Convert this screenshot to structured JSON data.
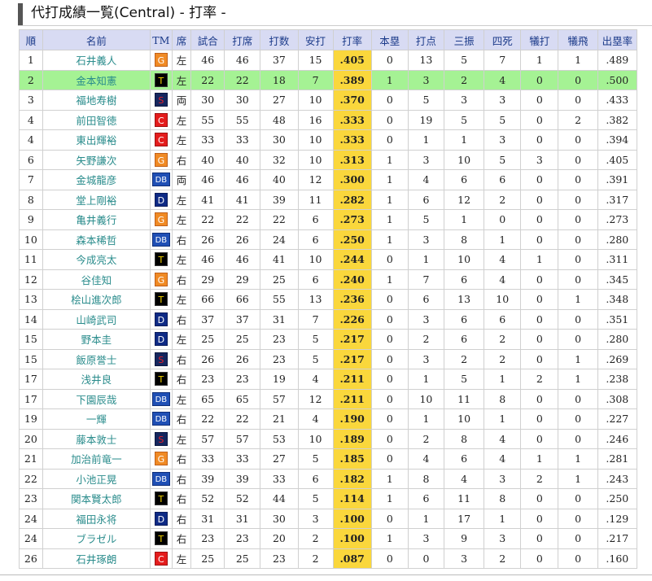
{
  "title": "代打成績一覧(Central) - 打率 -",
  "columns": [
    "順",
    "名前",
    "TM",
    "席",
    "試合",
    "打席",
    "打数",
    "安打",
    "打率",
    "本塁",
    "打点",
    "三振",
    "四死",
    "犠打",
    "犠飛",
    "出塁率"
  ],
  "colors": {
    "header_bg": "#d8dbf3",
    "avg_bg": "#fad73c",
    "highlight_row": "#a5f294",
    "name_text": "#2a8c8c"
  },
  "rows": [
    {
      "rank": "1",
      "name": "石井義人",
      "tm": "G",
      "hand": "左",
      "g": "46",
      "pa": "46",
      "ab": "37",
      "h": "15",
      "avg": ".405",
      "hr": "0",
      "rbi": "13",
      "so": "5",
      "bb": "7",
      "sh": "1",
      "sf": "1",
      "obp": ".489"
    },
    {
      "rank": "2",
      "name": "金本知憲",
      "tm": "T",
      "hand": "左",
      "g": "22",
      "pa": "22",
      "ab": "18",
      "h": "7",
      "avg": ".389",
      "hr": "1",
      "rbi": "3",
      "so": "2",
      "bb": "4",
      "sh": "0",
      "sf": "0",
      "obp": ".500",
      "highlight": true
    },
    {
      "rank": "3",
      "name": "福地寿樹",
      "tm": "S",
      "hand": "両",
      "g": "30",
      "pa": "30",
      "ab": "27",
      "h": "10",
      "avg": ".370",
      "hr": "0",
      "rbi": "5",
      "so": "3",
      "bb": "3",
      "sh": "0",
      "sf": "0",
      "obp": ".433"
    },
    {
      "rank": "4",
      "name": "前田智徳",
      "tm": "C",
      "hand": "左",
      "g": "55",
      "pa": "55",
      "ab": "48",
      "h": "16",
      "avg": ".333",
      "hr": "0",
      "rbi": "19",
      "so": "5",
      "bb": "5",
      "sh": "0",
      "sf": "2",
      "obp": ".382"
    },
    {
      "rank": "4",
      "name": "東出輝裕",
      "tm": "C",
      "hand": "左",
      "g": "33",
      "pa": "33",
      "ab": "30",
      "h": "10",
      "avg": ".333",
      "hr": "0",
      "rbi": "1",
      "so": "1",
      "bb": "3",
      "sh": "0",
      "sf": "0",
      "obp": ".394"
    },
    {
      "rank": "6",
      "name": "矢野謙次",
      "tm": "G",
      "hand": "右",
      "g": "40",
      "pa": "40",
      "ab": "32",
      "h": "10",
      "avg": ".313",
      "hr": "1",
      "rbi": "3",
      "so": "10",
      "bb": "5",
      "sh": "3",
      "sf": "0",
      "obp": ".405"
    },
    {
      "rank": "7",
      "name": "金城龍彦",
      "tm": "DB",
      "hand": "両",
      "g": "46",
      "pa": "46",
      "ab": "40",
      "h": "12",
      "avg": ".300",
      "hr": "1",
      "rbi": "4",
      "so": "6",
      "bb": "6",
      "sh": "0",
      "sf": "0",
      "obp": ".391"
    },
    {
      "rank": "8",
      "name": "堂上剛裕",
      "tm": "D",
      "hand": "左",
      "g": "41",
      "pa": "41",
      "ab": "39",
      "h": "11",
      "avg": ".282",
      "hr": "1",
      "rbi": "6",
      "so": "12",
      "bb": "2",
      "sh": "0",
      "sf": "0",
      "obp": ".317"
    },
    {
      "rank": "9",
      "name": "亀井義行",
      "tm": "G",
      "hand": "左",
      "g": "22",
      "pa": "22",
      "ab": "22",
      "h": "6",
      "avg": ".273",
      "hr": "1",
      "rbi": "5",
      "so": "1",
      "bb": "0",
      "sh": "0",
      "sf": "0",
      "obp": ".273"
    },
    {
      "rank": "10",
      "name": "森本稀哲",
      "tm": "DB",
      "hand": "右",
      "g": "26",
      "pa": "26",
      "ab": "24",
      "h": "6",
      "avg": ".250",
      "hr": "1",
      "rbi": "3",
      "so": "8",
      "bb": "1",
      "sh": "0",
      "sf": "0",
      "obp": ".280"
    },
    {
      "rank": "11",
      "name": "今成亮太",
      "tm": "T",
      "hand": "左",
      "g": "46",
      "pa": "46",
      "ab": "41",
      "h": "10",
      "avg": ".244",
      "hr": "0",
      "rbi": "1",
      "so": "10",
      "bb": "4",
      "sh": "1",
      "sf": "0",
      "obp": ".311"
    },
    {
      "rank": "12",
      "name": "谷佳知",
      "tm": "G",
      "hand": "右",
      "g": "29",
      "pa": "29",
      "ab": "25",
      "h": "6",
      "avg": ".240",
      "hr": "1",
      "rbi": "7",
      "so": "6",
      "bb": "4",
      "sh": "0",
      "sf": "0",
      "obp": ".345"
    },
    {
      "rank": "13",
      "name": "桧山進次郎",
      "tm": "T",
      "hand": "左",
      "g": "66",
      "pa": "66",
      "ab": "55",
      "h": "13",
      "avg": ".236",
      "hr": "0",
      "rbi": "6",
      "so": "13",
      "bb": "10",
      "sh": "0",
      "sf": "1",
      "obp": ".348"
    },
    {
      "rank": "14",
      "name": "山崎武司",
      "tm": "D",
      "hand": "右",
      "g": "37",
      "pa": "37",
      "ab": "31",
      "h": "7",
      "avg": ".226",
      "hr": "0",
      "rbi": "3",
      "so": "6",
      "bb": "6",
      "sh": "0",
      "sf": "0",
      "obp": ".351"
    },
    {
      "rank": "15",
      "name": "野本圭",
      "tm": "D",
      "hand": "左",
      "g": "25",
      "pa": "25",
      "ab": "23",
      "h": "5",
      "avg": ".217",
      "hr": "0",
      "rbi": "2",
      "so": "6",
      "bb": "2",
      "sh": "0",
      "sf": "0",
      "obp": ".280"
    },
    {
      "rank": "15",
      "name": "飯原誉士",
      "tm": "S",
      "hand": "右",
      "g": "26",
      "pa": "26",
      "ab": "23",
      "h": "5",
      "avg": ".217",
      "hr": "0",
      "rbi": "3",
      "so": "2",
      "bb": "2",
      "sh": "0",
      "sf": "1",
      "obp": ".269"
    },
    {
      "rank": "17",
      "name": "浅井良",
      "tm": "T",
      "hand": "右",
      "g": "23",
      "pa": "23",
      "ab": "19",
      "h": "4",
      "avg": ".211",
      "hr": "0",
      "rbi": "1",
      "so": "5",
      "bb": "1",
      "sh": "2",
      "sf": "1",
      "obp": ".238"
    },
    {
      "rank": "17",
      "name": "下園辰哉",
      "tm": "DB",
      "hand": "左",
      "g": "65",
      "pa": "65",
      "ab": "57",
      "h": "12",
      "avg": ".211",
      "hr": "0",
      "rbi": "10",
      "so": "11",
      "bb": "8",
      "sh": "0",
      "sf": "0",
      "obp": ".308"
    },
    {
      "rank": "19",
      "name": "一輝",
      "tm": "DB",
      "hand": "右",
      "g": "22",
      "pa": "22",
      "ab": "21",
      "h": "4",
      "avg": ".190",
      "hr": "0",
      "rbi": "1",
      "so": "10",
      "bb": "1",
      "sh": "0",
      "sf": "0",
      "obp": ".227"
    },
    {
      "rank": "20",
      "name": "藤本敦士",
      "tm": "S",
      "hand": "左",
      "g": "57",
      "pa": "57",
      "ab": "53",
      "h": "10",
      "avg": ".189",
      "hr": "0",
      "rbi": "2",
      "so": "8",
      "bb": "4",
      "sh": "0",
      "sf": "0",
      "obp": ".246"
    },
    {
      "rank": "21",
      "name": "加治前竜一",
      "tm": "G",
      "hand": "右",
      "g": "33",
      "pa": "33",
      "ab": "27",
      "h": "5",
      "avg": ".185",
      "hr": "0",
      "rbi": "4",
      "so": "6",
      "bb": "4",
      "sh": "1",
      "sf": "1",
      "obp": ".281"
    },
    {
      "rank": "22",
      "name": "小池正晃",
      "tm": "DB",
      "hand": "右",
      "g": "39",
      "pa": "39",
      "ab": "33",
      "h": "6",
      "avg": ".182",
      "hr": "1",
      "rbi": "8",
      "so": "4",
      "bb": "3",
      "sh": "2",
      "sf": "1",
      "obp": ".243"
    },
    {
      "rank": "23",
      "name": "関本賢太郎",
      "tm": "T",
      "hand": "右",
      "g": "52",
      "pa": "52",
      "ab": "44",
      "h": "5",
      "avg": ".114",
      "hr": "1",
      "rbi": "6",
      "so": "11",
      "bb": "8",
      "sh": "0",
      "sf": "0",
      "obp": ".250"
    },
    {
      "rank": "24",
      "name": "福田永将",
      "tm": "D",
      "hand": "右",
      "g": "31",
      "pa": "31",
      "ab": "30",
      "h": "3",
      "avg": ".100",
      "hr": "0",
      "rbi": "1",
      "so": "17",
      "bb": "1",
      "sh": "0",
      "sf": "0",
      "obp": ".129"
    },
    {
      "rank": "24",
      "name": "ブラゼル",
      "tm": "T",
      "hand": "右",
      "g": "23",
      "pa": "23",
      "ab": "20",
      "h": "2",
      "avg": ".100",
      "hr": "1",
      "rbi": "3",
      "so": "9",
      "bb": "3",
      "sh": "0",
      "sf": "0",
      "obp": ".217"
    },
    {
      "rank": "26",
      "name": "石井琢朗",
      "tm": "C",
      "hand": "左",
      "g": "25",
      "pa": "25",
      "ab": "23",
      "h": "2",
      "avg": ".087",
      "hr": "0",
      "rbi": "0",
      "so": "3",
      "bb": "2",
      "sh": "0",
      "sf": "0",
      "obp": ".160"
    }
  ]
}
